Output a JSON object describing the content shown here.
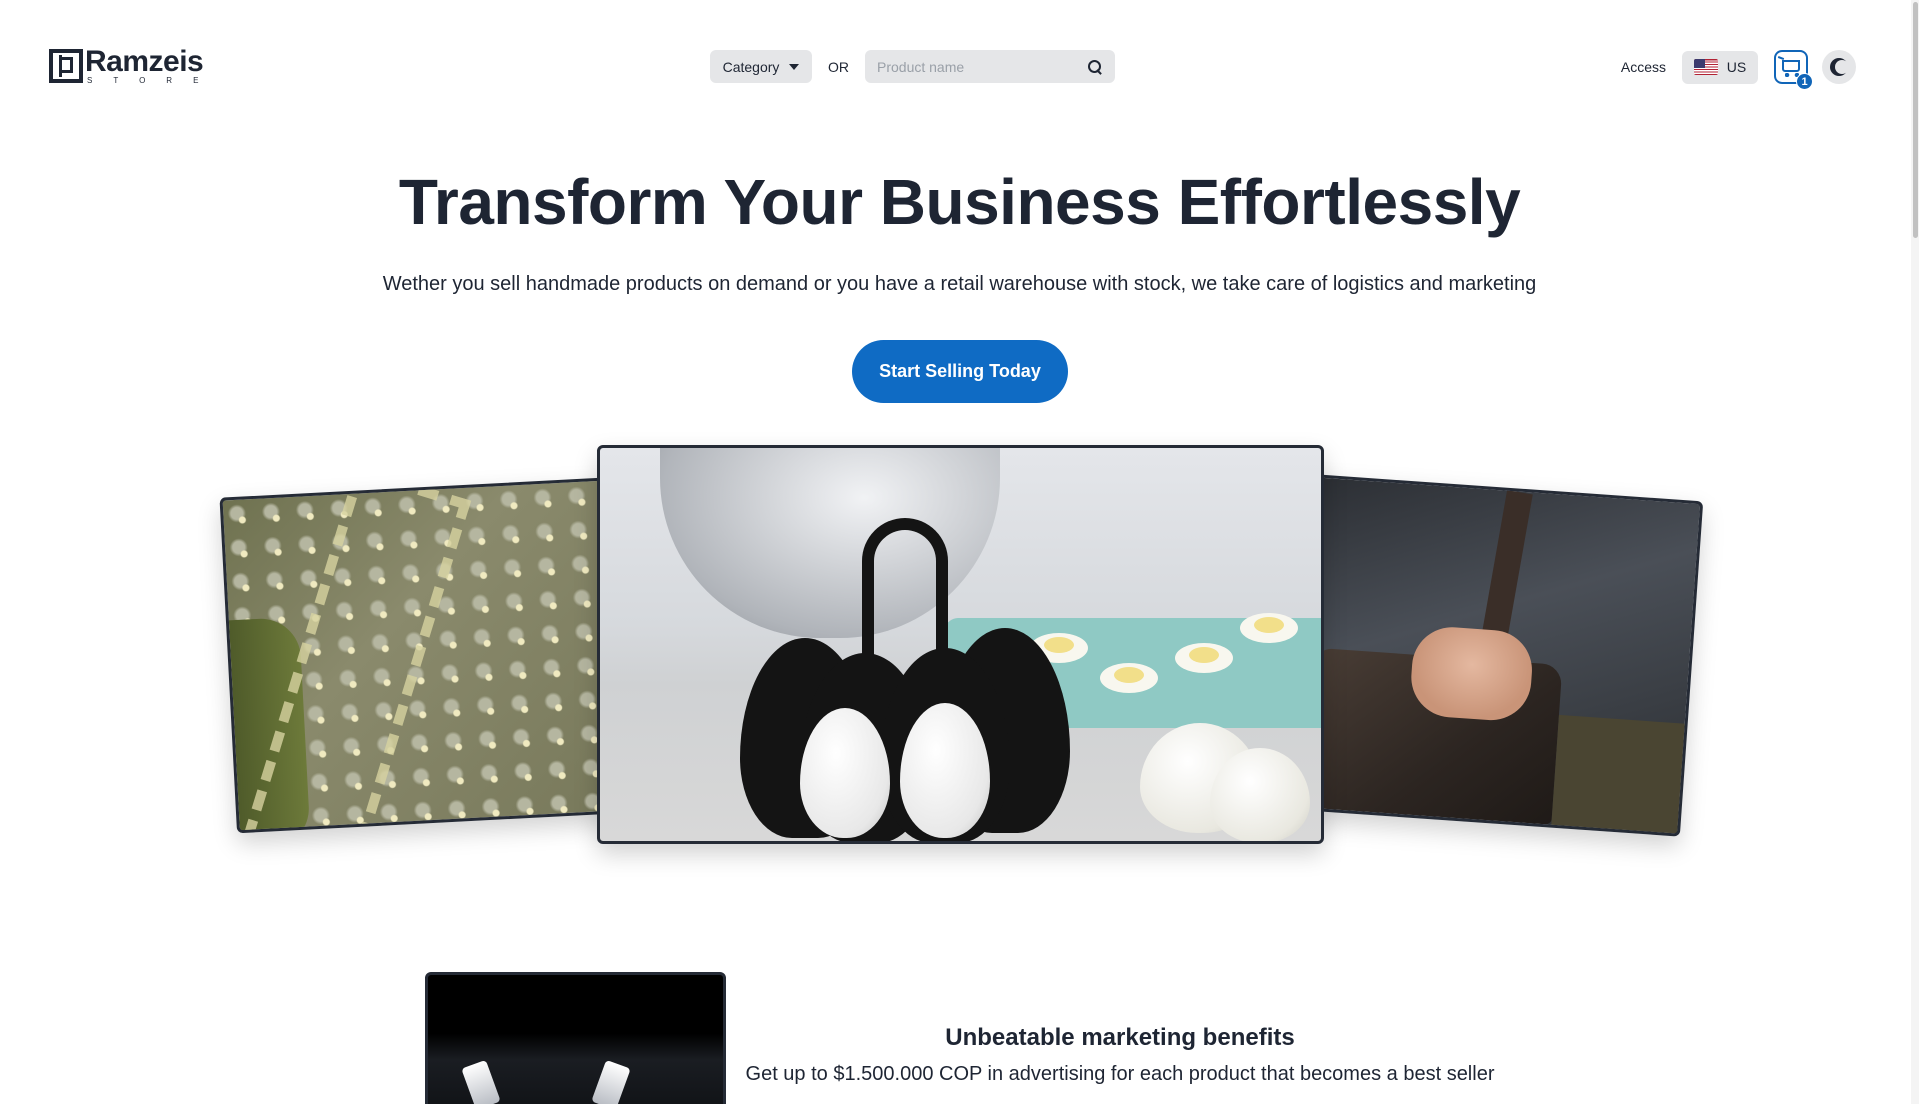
{
  "header": {
    "logo": {
      "name": "Ramzeis",
      "sub": "STORE"
    },
    "category_label": "Category",
    "or_label": "OR",
    "search": {
      "placeholder": "Product name",
      "value": ""
    },
    "access_label": "Access",
    "language": {
      "code": "US",
      "flag": "us-flag-icon"
    },
    "cart": {
      "count": "1",
      "icon": "cart-icon"
    },
    "theme_icon": "moon-icon"
  },
  "hero": {
    "title": "Transform Your Business Effortlessly",
    "subtitle": "Wether you sell handmade products on demand or you have a retail warehouse with stock, we take care of logistics and marketing",
    "cta_label": "Start Selling Today"
  },
  "feature": {
    "title": "Unbeatable marketing benefits",
    "description": "Get up to $1.500.000 COP in advertising for each product that becomes a best seller"
  },
  "colors": {
    "primary": "#0f6bc4",
    "text": "#1e2533",
    "pill_bg": "#e5e6e8"
  }
}
